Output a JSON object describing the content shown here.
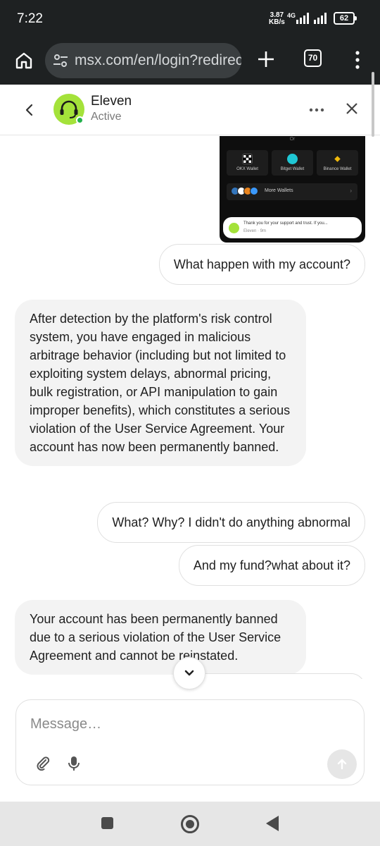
{
  "status_bar": {
    "time": "7:22",
    "net_speed_value": "3.87",
    "net_speed_unit": "KB/s",
    "network": "4G",
    "battery": "62"
  },
  "browser": {
    "url": "msx.com/en/login?redirect",
    "tab_count": "70"
  },
  "chat_header": {
    "agent_name": "Eleven",
    "agent_status": "Active",
    "avatar_color": "#a4e23a",
    "online_color": "#22b04b"
  },
  "shared_screenshot": {
    "or_label": "Or",
    "wallets": [
      {
        "label": "OKX Wallet",
        "icon": "okx-icon",
        "color": "#ffffff"
      },
      {
        "label": "Bitget Wallet",
        "icon": "bitget-icon",
        "color": "#1fc7d4"
      },
      {
        "label": "Binance Wallet",
        "icon": "binance-icon",
        "color": "#f0b90b"
      }
    ],
    "more_wallets_label": "More Wallets",
    "notification": {
      "text": "Thank you for your support and trust. If you...",
      "meta": "Eleven · 9m"
    }
  },
  "messages": [
    {
      "sender": "user",
      "text": "What happen with my account?"
    },
    {
      "sender": "agent",
      "text": "After detection by the platform's risk control system, you have engaged in malicious arbitrage behavior (including but not limited to exploiting system delays, abnormal pricing, bulk registration, or API manipulation to gain improper benefits), which constitutes a serious violation of the User Service Agreement. Your account has now been permanently banned."
    },
    {
      "sender": "user",
      "text": "What? Why? I didn't do anything abnormal"
    },
    {
      "sender": "user",
      "text": "And my fund?what about it?"
    },
    {
      "sender": "agent",
      "text": "Your account has been permanently banned due to a serious violation of the User Service Agreement and cannot be reinstated."
    }
  ],
  "composer": {
    "placeholder": "Message…"
  }
}
